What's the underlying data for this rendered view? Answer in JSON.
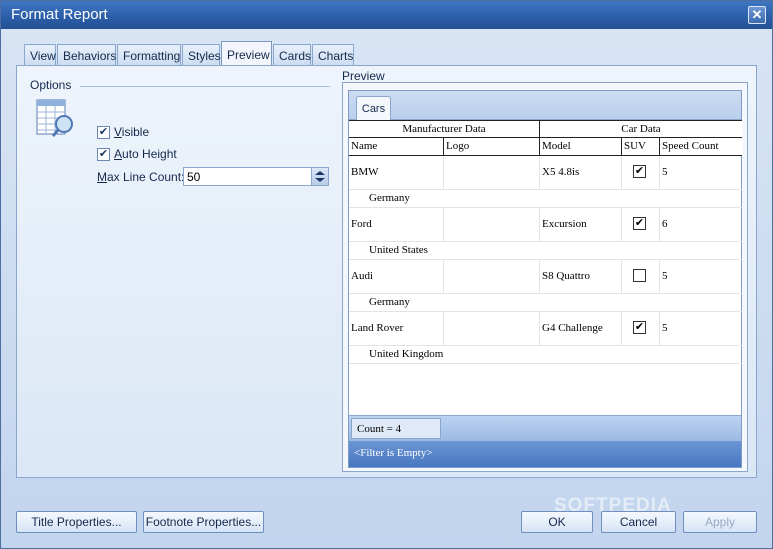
{
  "window": {
    "title": "Format Report"
  },
  "tabs": [
    "View",
    "Behaviors",
    "Formatting",
    "Styles",
    "Preview",
    "Cards",
    "Charts"
  ],
  "active_tab": "Preview",
  "options": {
    "group_label": "Options",
    "visible_label": "Visible",
    "visible_checked": true,
    "auto_height_label": "Auto Height",
    "auto_height_checked": true,
    "max_line_label": "Max Line Count:",
    "max_line_value": "50"
  },
  "preview": {
    "label": "Preview",
    "report_tab": "Cars",
    "band_headers": [
      "Manufacturer Data",
      "Car Data"
    ],
    "columns": [
      "Name",
      "Logo",
      "Model",
      "SUV",
      "Speed Count"
    ],
    "rows": [
      {
        "name": "BMW",
        "model": "X5 4.8is",
        "suv": true,
        "speed": "5",
        "country": "Germany"
      },
      {
        "name": "Ford",
        "model": "Excursion",
        "suv": true,
        "speed": "6",
        "country": "United States"
      },
      {
        "name": "Audi",
        "model": "S8 Quattro",
        "suv": false,
        "speed": "5",
        "country": "Germany"
      },
      {
        "name": "Land Rover",
        "model": "G4 Challenge",
        "suv": true,
        "speed": "5",
        "country": "United Kingdom"
      }
    ],
    "count_text": "Count = 4",
    "filter_text": "<Filter is Empty>"
  },
  "buttons": {
    "title_properties": "Title Properties...",
    "footnote_properties": "Footnote Properties...",
    "ok": "OK",
    "cancel": "Cancel",
    "apply": "Apply"
  },
  "watermark": "SOFTPEDIA",
  "icons": {
    "close": "close-icon",
    "options": "report-options-icon",
    "check": "checkmark-icon"
  }
}
